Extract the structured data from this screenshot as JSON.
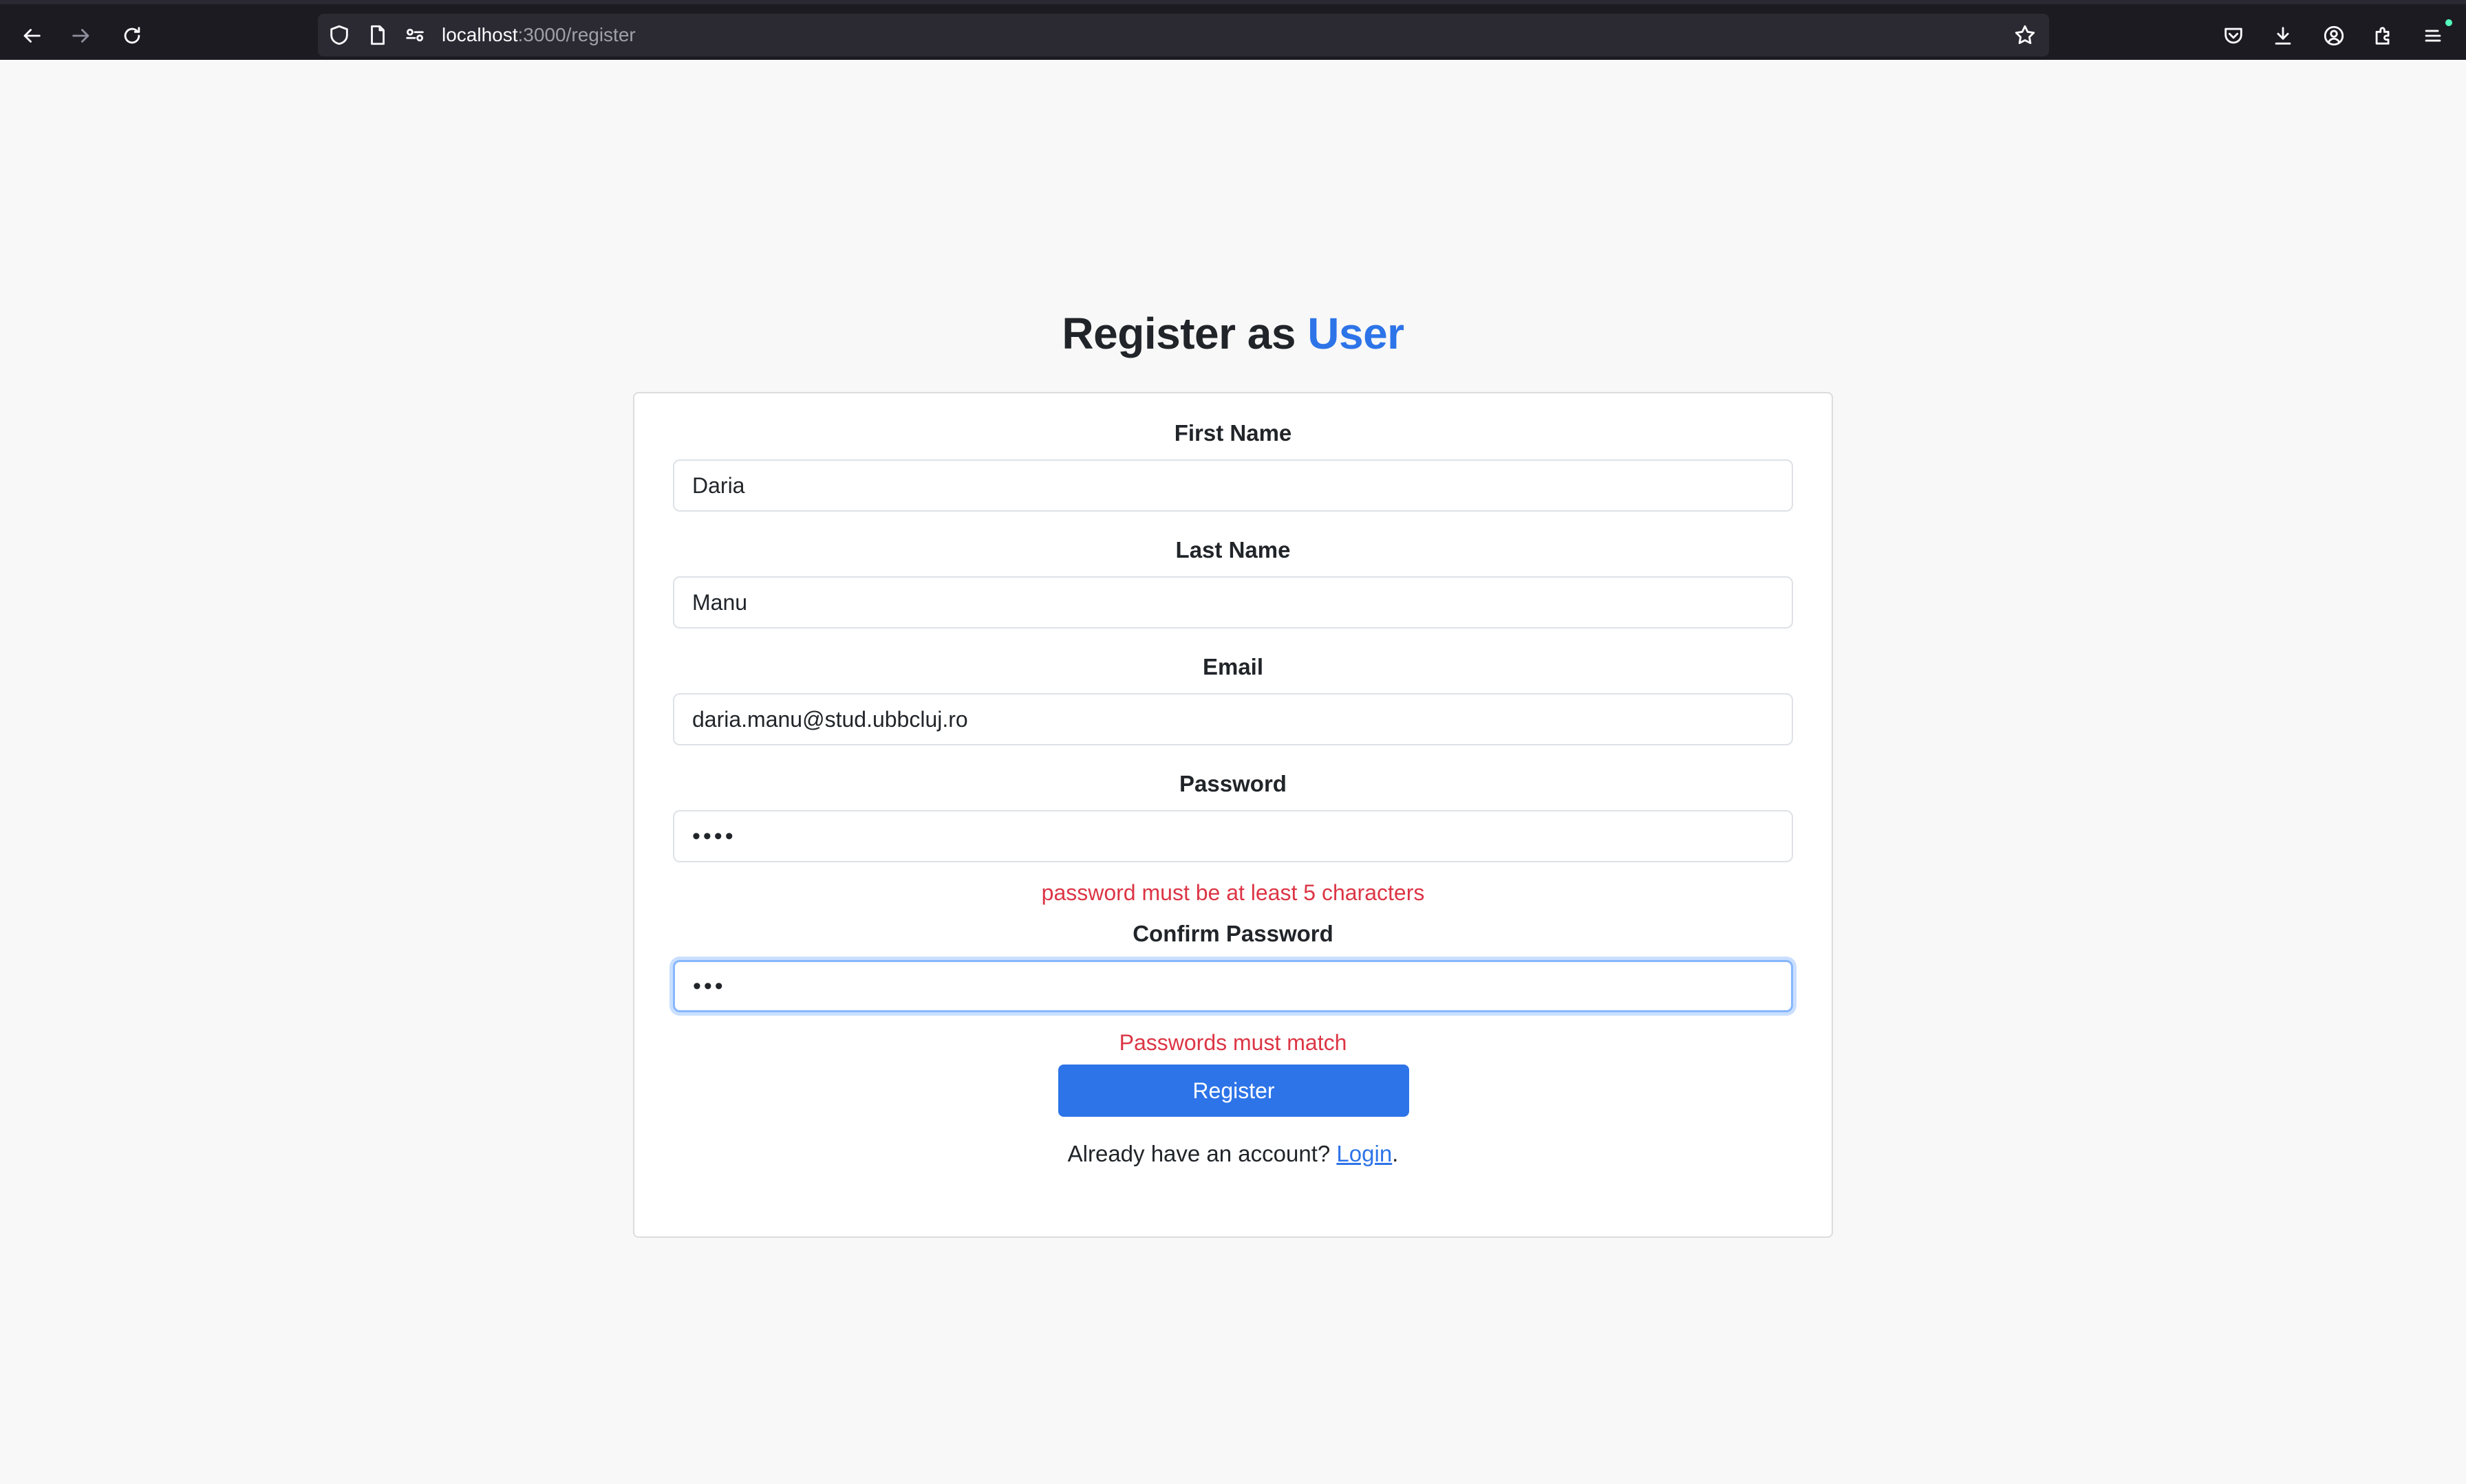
{
  "browser": {
    "url_host": "localhost",
    "url_path": ":3000/register"
  },
  "header": {
    "title_prefix": "Register as",
    "title_accent": "User"
  },
  "form": {
    "first_name": {
      "label": "First Name",
      "value": "Daria"
    },
    "last_name": {
      "label": "Last Name",
      "value": "Manu"
    },
    "email": {
      "label": "Email",
      "value": "daria.manu@stud.ubbcluj.ro"
    },
    "password": {
      "label": "Password",
      "value": "••••",
      "error": "password must be at least 5 characters"
    },
    "confirm_password": {
      "label": "Confirm Password",
      "value": "•••",
      "error": "Passwords must match"
    },
    "submit_label": "Register",
    "login_prompt": "Already have an account?",
    "login_link": "Login",
    "login_suffix": "."
  },
  "colors": {
    "accent": "#2d74e8",
    "error": "#dc3545",
    "toolbar": "#1c1b22"
  }
}
